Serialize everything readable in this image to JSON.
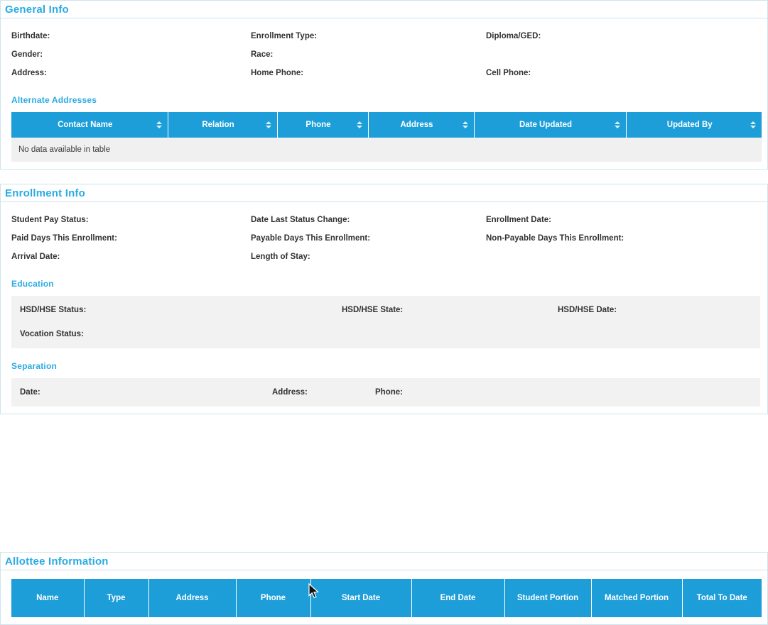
{
  "colors": {
    "accent_blue": "#29abe2",
    "table_header_bg": "#1d9ed9",
    "table_header_text": "#ffffff",
    "panel_border": "#cfe3ef",
    "label_text": "#323232",
    "empty_row_bg": "#f0f0f0",
    "subsection_block_bg": "#f2f2f2"
  },
  "icons": {
    "sort": "up-down-sort-arrows",
    "cursor": "arrow-pointer"
  },
  "general_info": {
    "title": "General Info",
    "fields": {
      "birthdate": "Birthdate:",
      "enrollment_type": "Enrollment Type:",
      "diploma_ged": "Diploma/GED:",
      "gender": "Gender:",
      "race": "Race:",
      "address": "Address:",
      "home_phone": "Home Phone:",
      "cell_phone": "Cell Phone:"
    },
    "alternate_addresses": {
      "title": "Alternate Addresses",
      "columns": [
        "Contact Name",
        "Relation",
        "Phone",
        "Address",
        "Date Updated",
        "Updated By"
      ],
      "empty_text": "No data available in table"
    }
  },
  "enrollment_info": {
    "title": "Enrollment Info",
    "fields": {
      "student_pay_status": "Student Pay Status:",
      "date_last_status_change": "Date Last Status Change:",
      "enrollment_date": "Enrollment Date:",
      "paid_days": "Paid Days This Enrollment:",
      "payable_days": "Payable Days This Enrollment:",
      "non_payable_days": "Non-Payable Days This Enrollment:",
      "arrival_date": "Arrival Date:",
      "length_of_stay": "Length of Stay:"
    },
    "education": {
      "title": "Education",
      "fields": {
        "hsd_status": "HSD/HSE Status:",
        "hsd_state": "HSD/HSE State:",
        "hsd_date": "HSD/HSE Date:",
        "vocation_status": "Vocation Status:"
      }
    },
    "separation": {
      "title": "Separation",
      "fields": {
        "date": "Date:",
        "address": "Address:",
        "phone": "Phone:"
      }
    }
  },
  "allottee": {
    "title": "Allottee Information",
    "columns": [
      "Name",
      "Type",
      "Address",
      "Phone",
      "Start Date",
      "End Date",
      "Student Portion",
      "Matched Portion",
      "Total To Date"
    ]
  }
}
